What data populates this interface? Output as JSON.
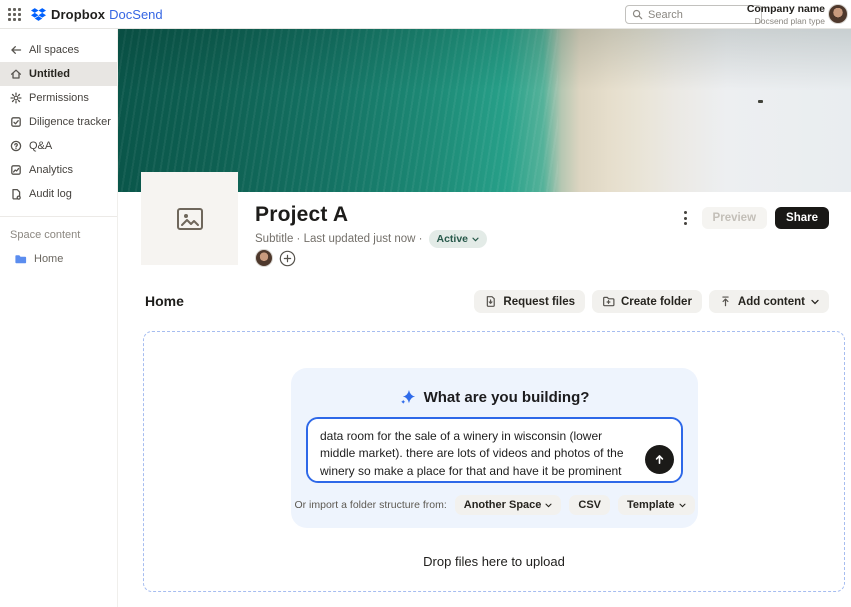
{
  "topbar": {
    "brand_name": "Dropbox",
    "product_name": "DocSend",
    "search_placeholder": "Search",
    "account": {
      "company": "Company name",
      "plan": "Docsend plan type"
    }
  },
  "sidebar": {
    "back_label": "All spaces",
    "items": [
      {
        "label": "Untitled",
        "icon": "home-icon",
        "active": true
      },
      {
        "label": "Permissions",
        "icon": "gear-icon",
        "active": false
      },
      {
        "label": "Diligence tracker",
        "icon": "checkbox-icon",
        "active": false
      },
      {
        "label": "Q&A",
        "icon": "question-icon",
        "active": false
      },
      {
        "label": "Analytics",
        "icon": "chart-icon",
        "active": false
      },
      {
        "label": "Audit log",
        "icon": "document-icon",
        "active": false
      }
    ],
    "section_label": "Space content",
    "content_items": [
      {
        "label": "Home",
        "icon": "folder-icon"
      }
    ]
  },
  "project": {
    "title": "Project A",
    "subtitle": "Subtitle · Last updated just now ·",
    "status": "Active",
    "preview_label": "Preview",
    "share_label": "Share"
  },
  "main": {
    "section_title": "Home",
    "toolbar": {
      "request_files_label": "Request files",
      "create_folder_label": "Create folder",
      "add_content_label": "Add content"
    },
    "ai_card": {
      "heading": "What are you building?",
      "prompt_text": "data room for the sale of a winery in wisconsin (lower middle market). there are lots of videos and photos of the winery so make a place for that and have it be prominent",
      "import_label": "Or import a folder structure from:",
      "import_options": [
        "Another Space",
        "CSV",
        "Template"
      ]
    },
    "dropzone_label": "Drop files here to upload"
  },
  "colors": {
    "accent_blue": "#2e68e8",
    "brand_blue": "#0061fe",
    "banner_teal": "#1d8a76",
    "active_pill_bg": "#e3ebe7",
    "active_pill_text": "#27584a",
    "share_button_bg": "#191816"
  }
}
